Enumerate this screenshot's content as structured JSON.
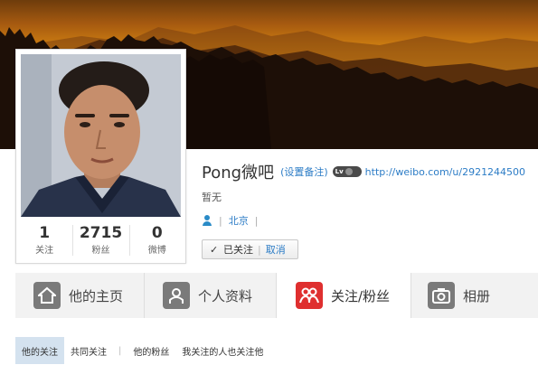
{
  "banner": {
    "scene": "sunset-mountain-silhouette"
  },
  "profile": {
    "name": "Pong微吧",
    "remark_link": "(设置备注)",
    "level_badge": "Lv",
    "url": "http://weibo.com/u/2921244500",
    "bio": "暂无",
    "location": "北京",
    "follow_state_label": "已关注",
    "cancel_label": "取消",
    "separator": "|"
  },
  "stats": [
    {
      "value": "1",
      "label": "关注"
    },
    {
      "value": "2715",
      "label": "粉丝"
    },
    {
      "value": "0",
      "label": "微博"
    }
  ],
  "tabs": [
    {
      "label": "他的主页",
      "icon": "home-icon"
    },
    {
      "label": "个人资料",
      "icon": "profile-icon"
    },
    {
      "label": "关注/粉丝",
      "icon": "follow-fans-icon",
      "active": true
    },
    {
      "label": "相册",
      "icon": "camera-icon"
    }
  ],
  "subtabs": {
    "his_following": "他的关注",
    "mutual_following": "共同关注",
    "his_fans": "他的粉丝",
    "i_follow_who_follow_him": "我关注的人也关注他",
    "separator": "|"
  },
  "colors": {
    "link": "#2c7cc6",
    "active_tab_icon": "#df2f2f",
    "tab_bar_bg": "#f2f2f2",
    "active_subtab_bg": "#d4e2ef"
  }
}
